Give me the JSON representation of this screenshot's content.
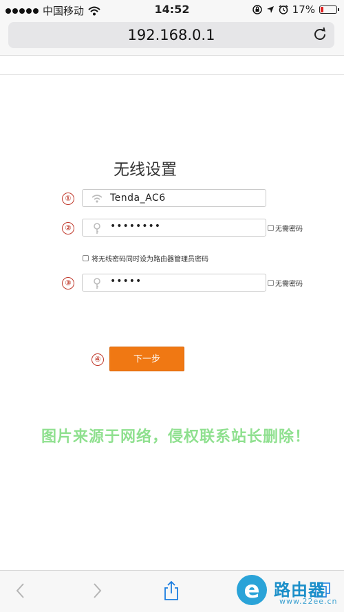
{
  "status_bar": {
    "carrier": "中国移动",
    "time": "14:52",
    "battery_percent": "17%",
    "battery_level": 0.17,
    "icons": [
      "signal-dots-icon",
      "wifi-icon",
      "rotation-lock-icon",
      "location-icon",
      "alarm-icon",
      "battery-icon"
    ]
  },
  "browser": {
    "url": "192.168.0.1",
    "reload_icon": "reload-icon",
    "toolbar_icons": [
      "back-arrow-icon",
      "forward-arrow-icon",
      "share-icon",
      "bookmarks-icon",
      "tabs-icon"
    ]
  },
  "page": {
    "title": "无线设置",
    "steps": [
      "①",
      "②",
      "③",
      "④"
    ],
    "ssid": {
      "value": "Tenda_AC6",
      "icon": "wifi-icon"
    },
    "wifi_password": {
      "value": "••••••••",
      "icon": "key-icon",
      "no_password_label": "无需密码"
    },
    "sync_label": "将无线密码同时设为路由器管理员密码",
    "admin_password": {
      "value": "•••••",
      "icon": "key-icon",
      "no_password_label": "无需密码"
    },
    "next_button": "下一步"
  },
  "watermark": "图片来源于网络，侵权联系站长删除！",
  "logo": {
    "brand": "路由器",
    "site": "www.22ee.cn",
    "letter": "e"
  },
  "colors": {
    "accent_orange": "#f07813",
    "step_red": "#c0392b",
    "watermark_green": "#8fe08f",
    "logo_blue": "#1b8fc9",
    "battery_red": "#e02020"
  }
}
